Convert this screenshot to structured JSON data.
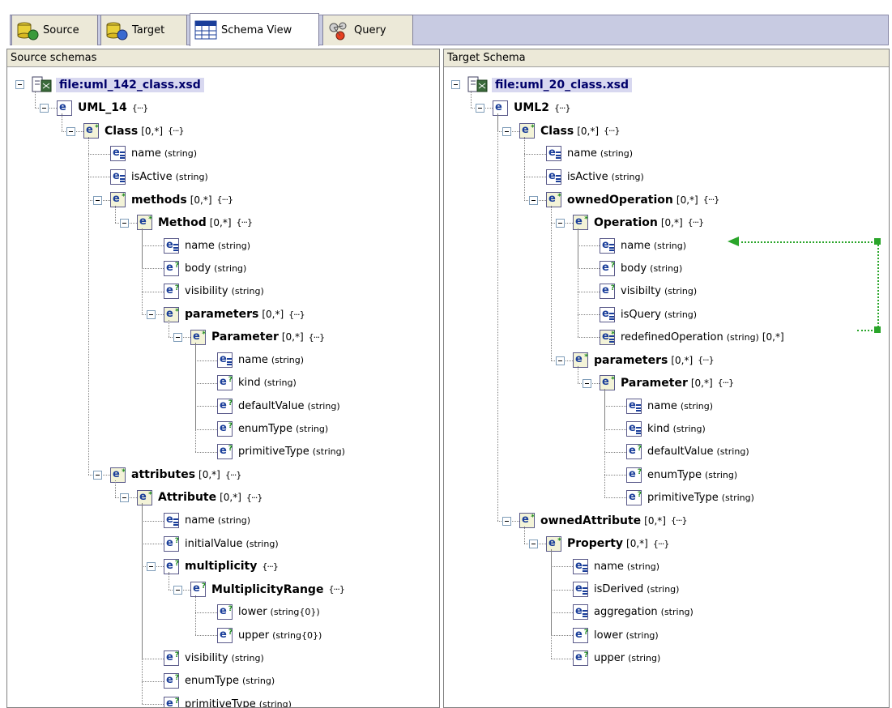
{
  "tabs": [
    {
      "label": "Source",
      "icon": "database-icon",
      "active": false
    },
    {
      "label": "Target",
      "icon": "database-target-icon",
      "active": false
    },
    {
      "label": "Schema View",
      "icon": "grid-icon",
      "active": true
    },
    {
      "label": "Query",
      "icon": "query-icon",
      "active": false
    }
  ],
  "source": {
    "header": "Source schemas",
    "file": "file:uml_142_class.xsd",
    "nodes": [
      {
        "depth": 1,
        "name": "UML_14",
        "bold": true,
        "type": "",
        "mult": "",
        "seq": "{···}",
        "icon": "e",
        "exp": true
      },
      {
        "depth": 2,
        "name": "Class",
        "bold": true,
        "type": "",
        "mult": "[0,*]",
        "seq": "{···}",
        "icon": "e*",
        "exp": true
      },
      {
        "depth": 3,
        "name": "name",
        "bold": false,
        "type": "(string)",
        "mult": "",
        "seq": "",
        "icon": "e=",
        "exp": false
      },
      {
        "depth": 3,
        "name": "isActive",
        "bold": false,
        "type": "(string)",
        "mult": "",
        "seq": "",
        "icon": "e=",
        "exp": false
      },
      {
        "depth": 3,
        "name": "methods",
        "bold": true,
        "type": "",
        "mult": "[0,*]",
        "seq": "{···}",
        "icon": "e*",
        "exp": true
      },
      {
        "depth": 4,
        "name": "Method",
        "bold": true,
        "type": "",
        "mult": "[0,*]",
        "seq": "{···}",
        "icon": "e*",
        "exp": true
      },
      {
        "depth": 5,
        "name": "name",
        "bold": false,
        "type": "(string)",
        "mult": "",
        "seq": "",
        "icon": "e=",
        "exp": false
      },
      {
        "depth": 5,
        "name": "body",
        "bold": false,
        "type": "(string)",
        "mult": "",
        "seq": "",
        "icon": "e?",
        "exp": false
      },
      {
        "depth": 5,
        "name": "visibility",
        "bold": false,
        "type": "(string)",
        "mult": "",
        "seq": "",
        "icon": "e?",
        "exp": false
      },
      {
        "depth": 5,
        "name": "parameters",
        "bold": true,
        "type": "",
        "mult": "[0,*]",
        "seq": "{···}",
        "icon": "e*",
        "exp": true
      },
      {
        "depth": 6,
        "name": "Parameter",
        "bold": true,
        "type": "",
        "mult": "[0,*]",
        "seq": "{···}",
        "icon": "e*",
        "exp": true
      },
      {
        "depth": 7,
        "name": "name",
        "bold": false,
        "type": "(string)",
        "mult": "",
        "seq": "",
        "icon": "e=",
        "exp": false
      },
      {
        "depth": 7,
        "name": "kind",
        "bold": false,
        "type": "(string)",
        "mult": "",
        "seq": "",
        "icon": "e?",
        "exp": false
      },
      {
        "depth": 7,
        "name": "defaultValue",
        "bold": false,
        "type": "(string)",
        "mult": "",
        "seq": "",
        "icon": "e?",
        "exp": false
      },
      {
        "depth": 7,
        "name": "enumType",
        "bold": false,
        "type": "(string)",
        "mult": "",
        "seq": "",
        "icon": "e?",
        "exp": false
      },
      {
        "depth": 7,
        "name": "primitiveType",
        "bold": false,
        "type": "(string)",
        "mult": "",
        "seq": "",
        "icon": "e?",
        "exp": false
      },
      {
        "depth": 3,
        "name": "attributes",
        "bold": true,
        "type": "",
        "mult": "[0,*]",
        "seq": "{···}",
        "icon": "e*",
        "exp": true
      },
      {
        "depth": 4,
        "name": "Attribute",
        "bold": true,
        "type": "",
        "mult": "[0,*]",
        "seq": "{···}",
        "icon": "e*",
        "exp": true
      },
      {
        "depth": 5,
        "name": "name",
        "bold": false,
        "type": "(string)",
        "mult": "",
        "seq": "",
        "icon": "e=",
        "exp": false
      },
      {
        "depth": 5,
        "name": "initialValue",
        "bold": false,
        "type": "(string)",
        "mult": "",
        "seq": "",
        "icon": "e?",
        "exp": false
      },
      {
        "depth": 5,
        "name": "multiplicity",
        "bold": true,
        "type": "",
        "mult": "",
        "seq": "{···}",
        "icon": "e?",
        "exp": true
      },
      {
        "depth": 6,
        "name": "MultiplicityRange",
        "bold": true,
        "type": "",
        "mult": "",
        "seq": "{···}",
        "icon": "e?",
        "exp": true
      },
      {
        "depth": 7,
        "name": "lower",
        "bold": false,
        "type": "(string{0})",
        "mult": "",
        "seq": "",
        "icon": "e?",
        "exp": false
      },
      {
        "depth": 7,
        "name": "upper",
        "bold": false,
        "type": "(string{0})",
        "mult": "",
        "seq": "",
        "icon": "e?",
        "exp": false
      },
      {
        "depth": 5,
        "name": "visibility",
        "bold": false,
        "type": "(string)",
        "mult": "",
        "seq": "",
        "icon": "e?",
        "exp": false
      },
      {
        "depth": 5,
        "name": "enumType",
        "bold": false,
        "type": "(string)",
        "mult": "",
        "seq": "",
        "icon": "e?",
        "exp": false
      },
      {
        "depth": 5,
        "name": "primitiveType",
        "bold": false,
        "type": "(string)",
        "mult": "",
        "seq": "",
        "icon": "e?",
        "exp": false
      }
    ]
  },
  "target": {
    "header": "Target Schema",
    "file": "file:uml_20_class.xsd",
    "nodes": [
      {
        "depth": 1,
        "name": "UML2",
        "bold": true,
        "type": "",
        "mult": "",
        "seq": "{···}",
        "icon": "e",
        "exp": true
      },
      {
        "depth": 2,
        "name": "Class",
        "bold": true,
        "type": "",
        "mult": "[0,*]",
        "seq": "{···}",
        "icon": "e*",
        "exp": true
      },
      {
        "depth": 3,
        "name": "name",
        "bold": false,
        "type": "(string)",
        "mult": "",
        "seq": "",
        "icon": "e=",
        "exp": false
      },
      {
        "depth": 3,
        "name": "isActive",
        "bold": false,
        "type": "(string)",
        "mult": "",
        "seq": "",
        "icon": "e=",
        "exp": false
      },
      {
        "depth": 3,
        "name": "ownedOperation",
        "bold": true,
        "type": "",
        "mult": "[0,*]",
        "seq": "{···}",
        "icon": "e*",
        "exp": true
      },
      {
        "depth": 4,
        "name": "Operation",
        "bold": true,
        "type": "",
        "mult": "[0,*]",
        "seq": "{···}",
        "icon": "e*",
        "exp": true
      },
      {
        "depth": 5,
        "name": "name",
        "bold": false,
        "type": "(string)",
        "mult": "",
        "seq": "",
        "icon": "e=",
        "exp": false
      },
      {
        "depth": 5,
        "name": "body",
        "bold": false,
        "type": "(string)",
        "mult": "",
        "seq": "",
        "icon": "e?",
        "exp": false
      },
      {
        "depth": 5,
        "name": "visibilty",
        "bold": false,
        "type": "(string)",
        "mult": "",
        "seq": "",
        "icon": "e?",
        "exp": false
      },
      {
        "depth": 5,
        "name": "isQuery",
        "bold": false,
        "type": "(string)",
        "mult": "",
        "seq": "",
        "icon": "e=",
        "exp": false
      },
      {
        "depth": 5,
        "name": "redefinedOperation",
        "bold": false,
        "type": "(string)",
        "mult": "[0,*]",
        "seq": "",
        "icon": "e*=",
        "exp": false
      },
      {
        "depth": 4,
        "name": "parameters",
        "bold": true,
        "type": "",
        "mult": "[0,*]",
        "seq": "{···}",
        "icon": "e*",
        "exp": true
      },
      {
        "depth": 5,
        "name": "Parameter",
        "bold": true,
        "type": "",
        "mult": "[0,*]",
        "seq": "{···}",
        "icon": "e*",
        "exp": true
      },
      {
        "depth": 6,
        "name": "name",
        "bold": false,
        "type": "(string)",
        "mult": "",
        "seq": "",
        "icon": "e=",
        "exp": false
      },
      {
        "depth": 6,
        "name": "kind",
        "bold": false,
        "type": "(string)",
        "mult": "",
        "seq": "",
        "icon": "e=",
        "exp": false
      },
      {
        "depth": 6,
        "name": "defaultValue",
        "bold": false,
        "type": "(string)",
        "mult": "",
        "seq": "",
        "icon": "e?",
        "exp": false
      },
      {
        "depth": 6,
        "name": "enumType",
        "bold": false,
        "type": "(string)",
        "mult": "",
        "seq": "",
        "icon": "e?",
        "exp": false
      },
      {
        "depth": 6,
        "name": "primitiveType",
        "bold": false,
        "type": "(string)",
        "mult": "",
        "seq": "",
        "icon": "e?",
        "exp": false
      },
      {
        "depth": 2,
        "name": "ownedAttribute",
        "bold": true,
        "type": "",
        "mult": "[0,*]",
        "seq": "{···}",
        "icon": "e*",
        "exp": true
      },
      {
        "depth": 3,
        "name": "Property",
        "bold": true,
        "type": "",
        "mult": "[0,*]",
        "seq": "{···}",
        "icon": "e*",
        "exp": true
      },
      {
        "depth": 4,
        "name": "name",
        "bold": false,
        "type": "(string)",
        "mult": "",
        "seq": "",
        "icon": "e=",
        "exp": false
      },
      {
        "depth": 4,
        "name": "isDerived",
        "bold": false,
        "type": "(string)",
        "mult": "",
        "seq": "",
        "icon": "e=",
        "exp": false
      },
      {
        "depth": 4,
        "name": "aggregation",
        "bold": false,
        "type": "(string)",
        "mult": "",
        "seq": "",
        "icon": "e=",
        "exp": false
      },
      {
        "depth": 4,
        "name": "lower",
        "bold": false,
        "type": "(string)",
        "mult": "",
        "seq": "",
        "icon": "e?",
        "exp": false
      },
      {
        "depth": 4,
        "name": "upper",
        "bold": false,
        "type": "(string)",
        "mult": "",
        "seq": "",
        "icon": "e?",
        "exp": false
      }
    ]
  },
  "colors": {
    "link": "#2aa52a",
    "file_highlight": "#d8d8f0",
    "tabstrip": "#c8cbe2"
  }
}
